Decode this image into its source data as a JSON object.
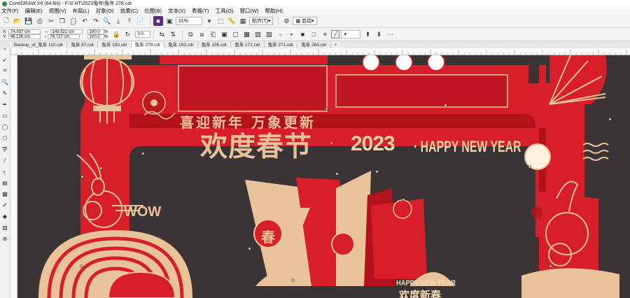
{
  "window": {
    "title": "CorelDRAW X8 (64-Bit) - F:\\0 HT\\2023兔年\\兔年 278.cdr"
  },
  "menu": [
    "文件(F)",
    "编辑(E)",
    "视图(V)",
    "布局(L)",
    "对象(O)",
    "效果(C)",
    "位图(B)",
    "文本(X)",
    "表格(T)",
    "工具(O)",
    "窗口(W)",
    "帮助(H)"
  ],
  "toolbar": {
    "zoom": "31%",
    "snap_label": "贴齐(T)",
    "launch_label": "启动"
  },
  "property_bar": {
    "x_label": "X:",
    "x_value": "74.837 cm",
    "y_label": "Y:",
    "y_value": "48.136 cm",
    "w_value": "149.521 cm",
    "h_value": "78.727 cm",
    "scale_w": "100.0",
    "scale_h": "100.0",
    "pct": "%",
    "angle": "0.0"
  },
  "tabs": [
    "Backup_of_兔年 110.cdr",
    "兔年 87.cdr",
    "兔年 150.cdr",
    "兔年 278.cdr",
    "兔年 193.cdr",
    "兔年 195.cdr",
    "兔年 171.cdr",
    "兔年 271.cdr",
    "兔年 265.cdr"
  ],
  "active_tab_index": 3,
  "artwork": {
    "main_title": "欢度春节",
    "year": "2023",
    "separator": "·",
    "hny": "HAPPY NEW YEAR",
    "wow": "WOW",
    "small_hny": "HAPPY NEW YEAR",
    "small_cn": "欢度新春",
    "chun": "春",
    "top_text": "喜迎新年 万象更新",
    "colors": {
      "red": "#d81e28",
      "dark_red": "#b3121c",
      "gold": "#e8c298",
      "canvas": "#3a3436"
    }
  }
}
